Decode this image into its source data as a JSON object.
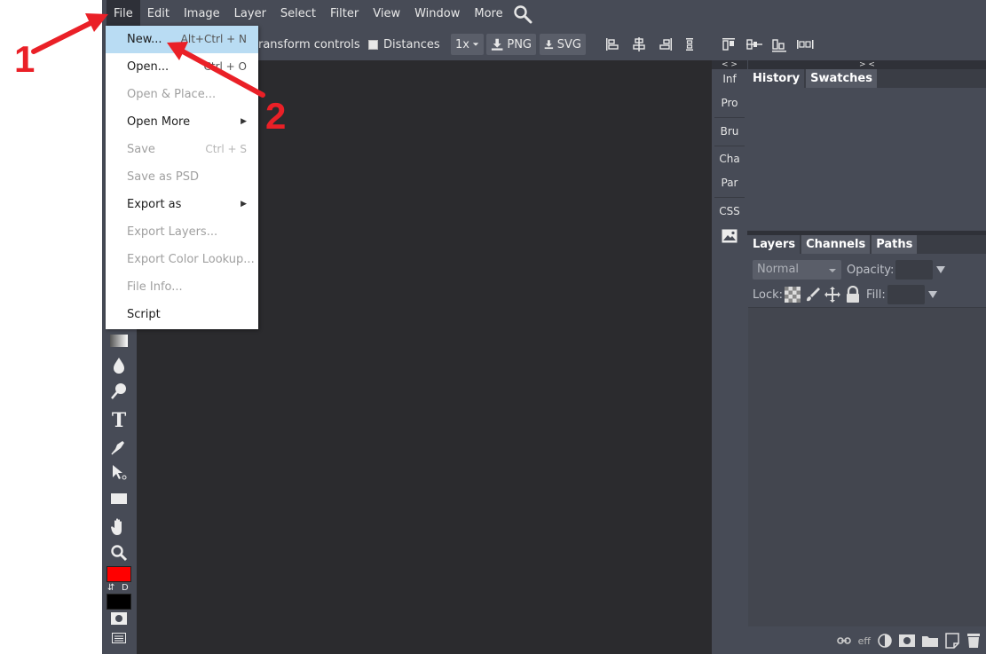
{
  "menubar": {
    "items": [
      "File",
      "Edit",
      "Image",
      "Layer",
      "Select",
      "Filter",
      "View",
      "Window",
      "More"
    ],
    "search_icon": "search-icon"
  },
  "toolbar": {
    "transform_label": "ransform controls",
    "distances_label": "Distances",
    "zoom_label": "1x",
    "png_label": "PNG",
    "svg_label": "SVG"
  },
  "file_menu": {
    "items": [
      {
        "label": "New...",
        "shortcut": "Alt+Ctrl + N",
        "enabled": true,
        "highlighted": true
      },
      {
        "label": "Open...",
        "shortcut": "Ctrl + O",
        "enabled": true
      },
      {
        "label": "Open & Place...",
        "shortcut": "",
        "enabled": false
      },
      {
        "label": "Open More",
        "shortcut": "",
        "enabled": true,
        "submenu": true
      },
      {
        "label": "Save",
        "shortcut": "Ctrl + S",
        "enabled": false
      },
      {
        "label": "Save as PSD",
        "shortcut": "",
        "enabled": false
      },
      {
        "label": "Export as",
        "shortcut": "",
        "enabled": true,
        "submenu": true
      },
      {
        "label": "Export Layers...",
        "shortcut": "",
        "enabled": false
      },
      {
        "label": "Export Color Lookup...",
        "shortcut": "",
        "enabled": false
      },
      {
        "label": "File Info...",
        "shortcut": "",
        "enabled": false
      },
      {
        "label": "Script",
        "shortcut": "",
        "enabled": true
      }
    ]
  },
  "mini_panels": {
    "header": "< >",
    "items": [
      "Inf",
      "Pro",
      "Bru",
      "Cha",
      "Par",
      "CSS"
    ]
  },
  "right_panel": {
    "header": "> <",
    "top_tabs": [
      "History",
      "Swatches"
    ],
    "layer_tabs": [
      "Layers",
      "Channels",
      "Paths"
    ],
    "blend_mode": "Normal",
    "opacity_label": "Opacity:",
    "lock_label": "Lock:",
    "fill_label": "Fill:",
    "footer_eff": "eff"
  },
  "tools": {
    "text_tool": "T",
    "swap_label": "⇵",
    "default_label": "D"
  },
  "colors": {
    "foreground": "#ff0000",
    "background": "#000000",
    "annotation": "#ea2027"
  },
  "annotations": {
    "step1": "1",
    "step2": "2"
  }
}
